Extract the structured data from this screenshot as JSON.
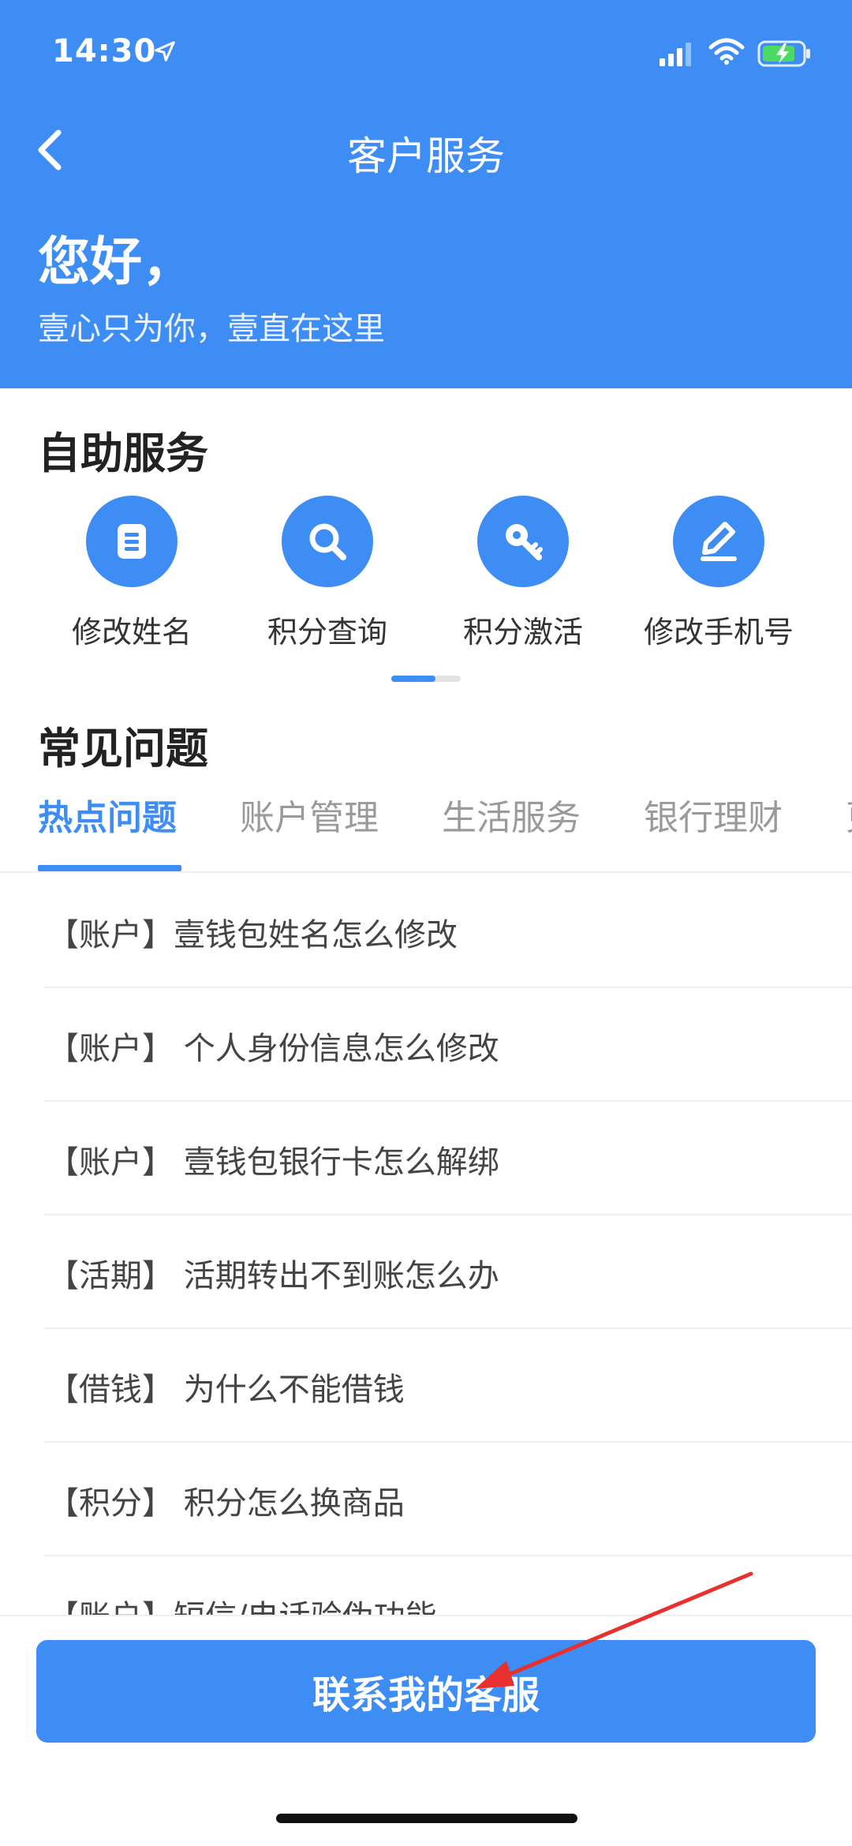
{
  "status_bar": {
    "time": "14:30"
  },
  "header": {
    "title": "客户服务",
    "greeting": "您好，",
    "subtitle": "壹心只为你，壹直在这里"
  },
  "self_service": {
    "title": "自助服务",
    "items": [
      {
        "label": "修改姓名",
        "icon": "document-icon"
      },
      {
        "label": "积分查询",
        "icon": "search-icon"
      },
      {
        "label": "积分激活",
        "icon": "key-icon"
      },
      {
        "label": "修改手机号",
        "icon": "edit-icon"
      }
    ]
  },
  "faq": {
    "title": "常见问题",
    "tabs": [
      "热点问题",
      "账户管理",
      "生活服务",
      "银行理财",
      "更"
    ],
    "active_tab": "热点问题",
    "items": [
      "【账户】壹钱包姓名怎么修改",
      "【账户】 个人身份信息怎么修改",
      "【账户】 壹钱包银行卡怎么解绑",
      "【活期】 活期转出不到账怎么办",
      "【借钱】 为什么不能借钱",
      "【积分】 积分怎么换商品",
      "【账户】短信/电话验伪功能"
    ]
  },
  "bottom": {
    "contact_button": "联系我的客服"
  },
  "colors": {
    "accent": "#3d8df5",
    "annotation_arrow": "#e8312f"
  }
}
